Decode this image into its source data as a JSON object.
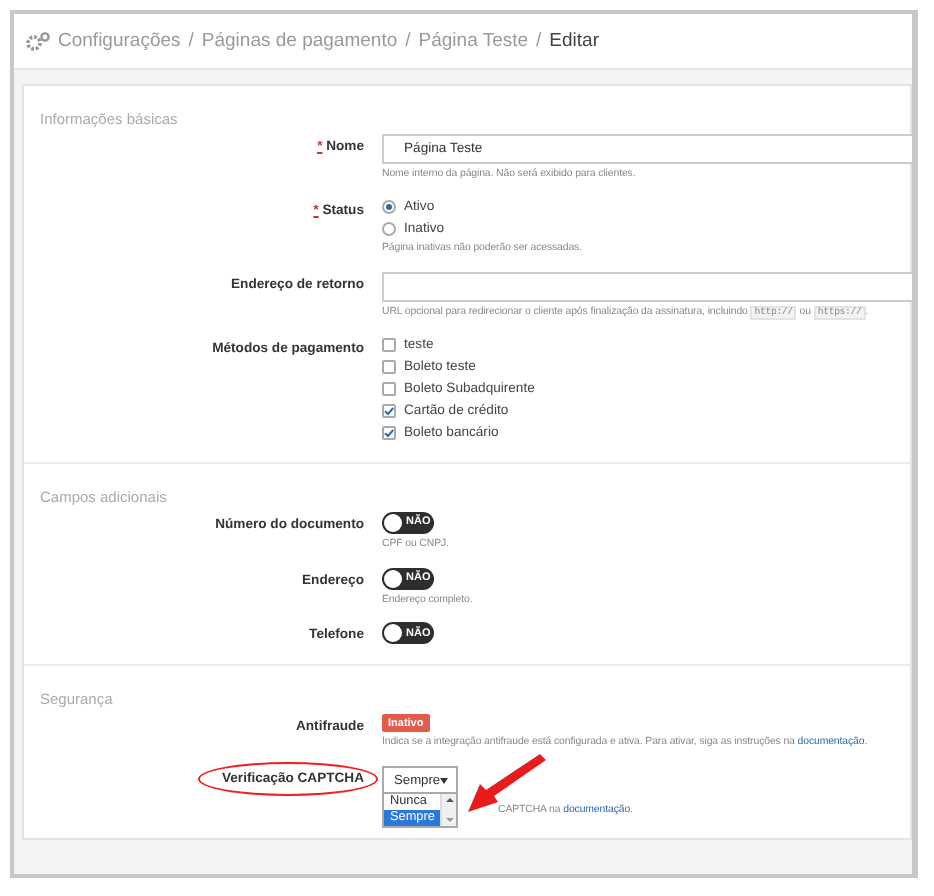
{
  "breadcrumb": {
    "items": [
      "Configurações",
      "Páginas de pagamento",
      "Página Teste"
    ],
    "separator": "/",
    "current": "Editar"
  },
  "sections": [
    {
      "title": "Informações básicas",
      "fields": [
        {
          "kind": "text",
          "label": "Nome",
          "required_mark": "*",
          "value": "Página Teste",
          "help": [
            {
              "kind": "text",
              "text": "Nome interno da página. Não será exibido para clientes."
            }
          ]
        },
        {
          "kind": "radio",
          "label": "Status",
          "required_mark": "*",
          "options": [
            {
              "label": "Ativo",
              "selected": true
            },
            {
              "label": "Inativo",
              "selected": false
            }
          ],
          "help": [
            {
              "kind": "text",
              "text": "Página inativas não poderão ser acessadas."
            }
          ]
        },
        {
          "kind": "text",
          "label": "Endereço de retorno",
          "help": [
            {
              "kind": "text",
              "text": "URL opcional para redirecionar o cliente após finalização da assinatura, incluindo "
            },
            {
              "kind": "code",
              "text": "http://"
            },
            {
              "kind": "text",
              "text": " ou "
            },
            {
              "kind": "code",
              "text": "https://"
            },
            {
              "kind": "text",
              "text": "."
            }
          ]
        },
        {
          "kind": "checkboxes",
          "label": "Métodos de pagamento",
          "options": [
            {
              "label": "teste",
              "checked": false
            },
            {
              "label": "Boleto teste",
              "checked": false
            },
            {
              "label": "Boleto Subadquirente",
              "checked": false
            },
            {
              "label": "Cartão de crédito",
              "checked": true
            },
            {
              "label": "Boleto bancário",
              "checked": true
            }
          ]
        }
      ]
    },
    {
      "title": "Campos adicionais",
      "fields": [
        {
          "kind": "toggle",
          "label": "Número do documento",
          "on": false,
          "state_label": "NÃO",
          "help": [
            {
              "kind": "text",
              "text": "CPF ou CNPJ."
            }
          ]
        },
        {
          "kind": "toggle",
          "label": "Endereço",
          "on": false,
          "state_label": "NÃO",
          "help": [
            {
              "kind": "text",
              "text": "Endereço completo."
            }
          ]
        },
        {
          "kind": "toggle",
          "label": "Telefone",
          "on": false,
          "state_label": "NÃO"
        }
      ]
    },
    {
      "title": "Segurança",
      "fields": [
        {
          "kind": "badge",
          "label": "Antifraude",
          "badge": "Inativo",
          "help": [
            {
              "kind": "text",
              "text": "Indica se a integração antifraude está configurada e ativa. Para ativar, siga as instruções na "
            },
            {
              "kind": "link",
              "text": "documentação"
            },
            {
              "kind": "text",
              "text": "."
            }
          ]
        },
        {
          "kind": "select",
          "label": "Verificação CAPTCHA",
          "circled": true,
          "arrow": true,
          "value": "Sempre",
          "expanded": true,
          "options": [
            {
              "label": "Nunca",
              "selected": false
            },
            {
              "label": "Sempre",
              "selected": true
            }
          ],
          "help": [
            {
              "kind": "text",
              "text": "CAPTCHA na "
            },
            {
              "kind": "link",
              "text": "documentação"
            },
            {
              "kind": "text",
              "text": "."
            }
          ]
        }
      ]
    }
  ]
}
